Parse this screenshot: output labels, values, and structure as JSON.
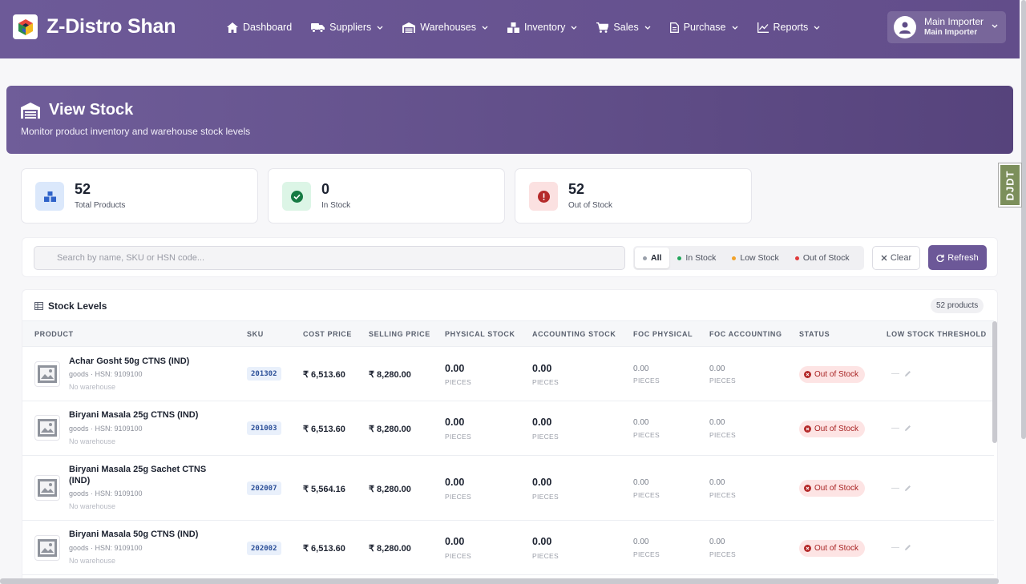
{
  "brand": {
    "name": "Z-Distro Shan"
  },
  "nav": {
    "items": [
      {
        "label": "Dashboard",
        "icon": "home-icon",
        "dropdown": false
      },
      {
        "label": "Suppliers",
        "icon": "truck-icon",
        "dropdown": true
      },
      {
        "label": "Warehouses",
        "icon": "warehouse-icon",
        "dropdown": true
      },
      {
        "label": "Inventory",
        "icon": "boxes-icon",
        "dropdown": true
      },
      {
        "label": "Sales",
        "icon": "cart-icon",
        "dropdown": true
      },
      {
        "label": "Purchase",
        "icon": "document-icon",
        "dropdown": true
      },
      {
        "label": "Reports",
        "icon": "chart-line-icon",
        "dropdown": true
      }
    ]
  },
  "user": {
    "name": "Main Importer",
    "role": "Main Importer"
  },
  "header": {
    "title": "View Stock",
    "subtitle": "Monitor product inventory and warehouse stock levels"
  },
  "stats": [
    {
      "value": "52",
      "label": "Total Products",
      "icon": "boxes-icon",
      "color": "#dbe8fb"
    },
    {
      "value": "0",
      "label": "In Stock",
      "icon": "check-circle-icon",
      "color": "#dcf5e6"
    },
    {
      "value": "52",
      "label": "Out of Stock",
      "icon": "alert-circle-icon",
      "color": "#fbe1e1"
    }
  ],
  "filters": {
    "search_placeholder": "Search by name, SKU or HSN code...",
    "segments": [
      {
        "label": "All",
        "dot": "#9aa0ab",
        "active": true
      },
      {
        "label": "In Stock",
        "dot": "#22a55b",
        "active": false
      },
      {
        "label": "Low Stock",
        "dot": "#f2a22a",
        "active": false
      },
      {
        "label": "Out of Stock",
        "dot": "#e03b3b",
        "active": false
      }
    ],
    "clear_label": "Clear",
    "refresh_label": "Refresh"
  },
  "table": {
    "title": "Stock Levels",
    "count_label": "52 products",
    "columns": [
      "PRODUCT",
      "SKU",
      "COST PRICE",
      "SELLING PRICE",
      "PHYSICAL STOCK",
      "ACCOUNTING STOCK",
      "FOC PHYSICAL",
      "FOC ACCOUNTING",
      "STATUS",
      "LOW STOCK THRESHOLD"
    ],
    "rows": [
      {
        "name": "Achar Gosht 50g CTNS (IND)",
        "meta": "goods · HSN: 9109100",
        "warehouse": "No warehouse",
        "sku": "201302",
        "cost": "₹ 6,513.60",
        "selling": "₹ 8,280.00",
        "physical": "0.00",
        "accounting": "0.00",
        "foc_physical": "0.00",
        "foc_accounting": "0.00",
        "unit": "PIECES",
        "status": "Out of Stock",
        "threshold": "—"
      },
      {
        "name": "Biryani Masala 25g CTNS (IND)",
        "meta": "goods · HSN: 9109100",
        "warehouse": "No warehouse",
        "sku": "201003",
        "cost": "₹ 6,513.60",
        "selling": "₹ 8,280.00",
        "physical": "0.00",
        "accounting": "0.00",
        "foc_physical": "0.00",
        "foc_accounting": "0.00",
        "unit": "PIECES",
        "status": "Out of Stock",
        "threshold": "—"
      },
      {
        "name": "Biryani Masala 25g Sachet CTNS (IND)",
        "meta": "goods · HSN: 9109100",
        "warehouse": "No warehouse",
        "sku": "202007",
        "cost": "₹ 5,564.16",
        "selling": "₹ 8,280.00",
        "physical": "0.00",
        "accounting": "0.00",
        "foc_physical": "0.00",
        "foc_accounting": "0.00",
        "unit": "PIECES",
        "status": "Out of Stock",
        "threshold": "—"
      },
      {
        "name": "Biryani Masala 50g CTNS (IND)",
        "meta": "goods · HSN: 9109100",
        "warehouse": "No warehouse",
        "sku": "202002",
        "cost": "₹ 6,513.60",
        "selling": "₹ 8,280.00",
        "physical": "0.00",
        "accounting": "0.00",
        "foc_physical": "0.00",
        "foc_accounting": "0.00",
        "unit": "PIECES",
        "status": "Out of Stock",
        "threshold": "—"
      }
    ]
  },
  "debug_toolbar": {
    "label": "DJDT"
  }
}
